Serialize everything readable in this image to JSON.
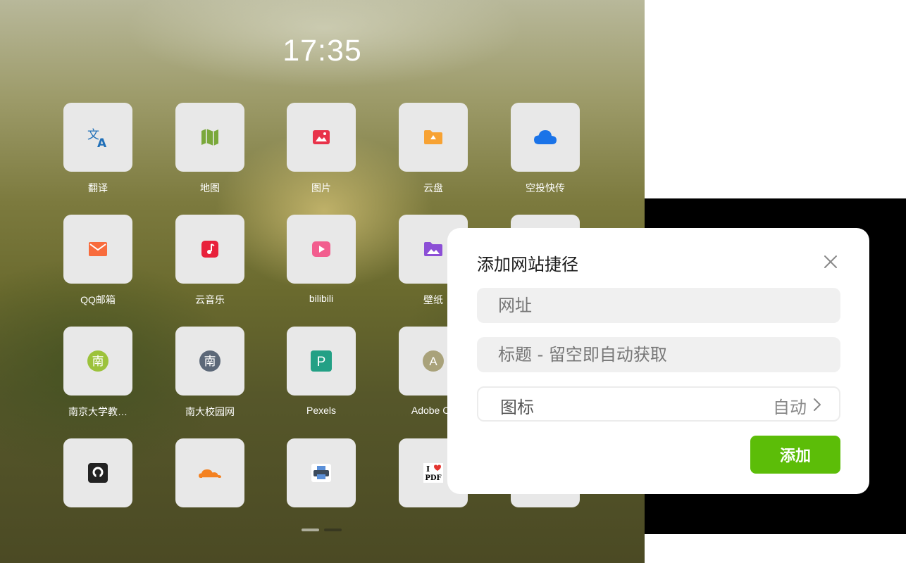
{
  "clock": {
    "time": "17:35"
  },
  "apps": [
    {
      "label": "翻译",
      "icon": "translate-icon"
    },
    {
      "label": "地图",
      "icon": "map-icon"
    },
    {
      "label": "图片",
      "icon": "image-icon"
    },
    {
      "label": "云盘",
      "icon": "cloud-drive-icon"
    },
    {
      "label": "空投快传",
      "icon": "cloud-icon"
    },
    {
      "label": "QQ邮箱",
      "icon": "mail-icon"
    },
    {
      "label": "云音乐",
      "icon": "music-icon"
    },
    {
      "label": "bilibili",
      "icon": "play-icon"
    },
    {
      "label": "壁纸",
      "icon": "wallpaper-icon"
    },
    {
      "label": "南京大学教…",
      "icon": "nju-letter-icon",
      "glyph": "南"
    },
    {
      "label": "南大校园网",
      "icon": "nju-campus-letter-icon",
      "glyph": "南"
    },
    {
      "label": "Pexels",
      "icon": "pexels-icon",
      "glyph": "P"
    },
    {
      "label": "Adobe Co",
      "icon": "adobe-letter-icon",
      "glyph": "A"
    },
    {
      "label": "",
      "icon": "github-icon"
    },
    {
      "label": "",
      "icon": "cloudflare-icon"
    },
    {
      "label": "",
      "icon": "printer-icon"
    },
    {
      "label": "",
      "icon": "ilovepdf-icon",
      "glyph_top": "I",
      "glyph_bottom": "PDF"
    }
  ],
  "dialog": {
    "title": "添加网站捷径",
    "url_placeholder": "网址",
    "title_placeholder": "标题 - 留空即自动获取",
    "icon_label": "图标",
    "icon_value": "自动",
    "add_button": "添加"
  },
  "colors": {
    "accent_green": "#5cbd08",
    "tile_bg": "#e8e8e8"
  },
  "pagination": {
    "pages": 2,
    "current": 1
  }
}
